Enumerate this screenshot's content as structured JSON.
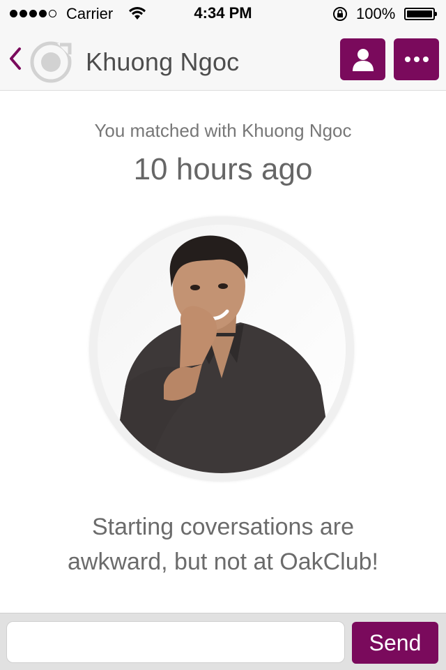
{
  "status_bar": {
    "carrier": "Carrier",
    "time": "4:34 PM",
    "battery_percent": "100%",
    "signal_bars": 4,
    "signal_total": 5
  },
  "nav": {
    "title": "Khuong Ngoc",
    "back_icon": "chevron-left-icon",
    "profile_icon": "person-icon",
    "more_icon": "more-dots-icon"
  },
  "match": {
    "label": "You matched with Khuong Ngoc",
    "time_ago": "10 hours ago"
  },
  "message": {
    "line1": "Starting coversations are",
    "line2": "awkward, but not at OakClub!"
  },
  "input": {
    "value": "",
    "send_label": "Send"
  },
  "colors": {
    "accent": "#7a0a5c",
    "bar_background": "#f7f7f7"
  }
}
